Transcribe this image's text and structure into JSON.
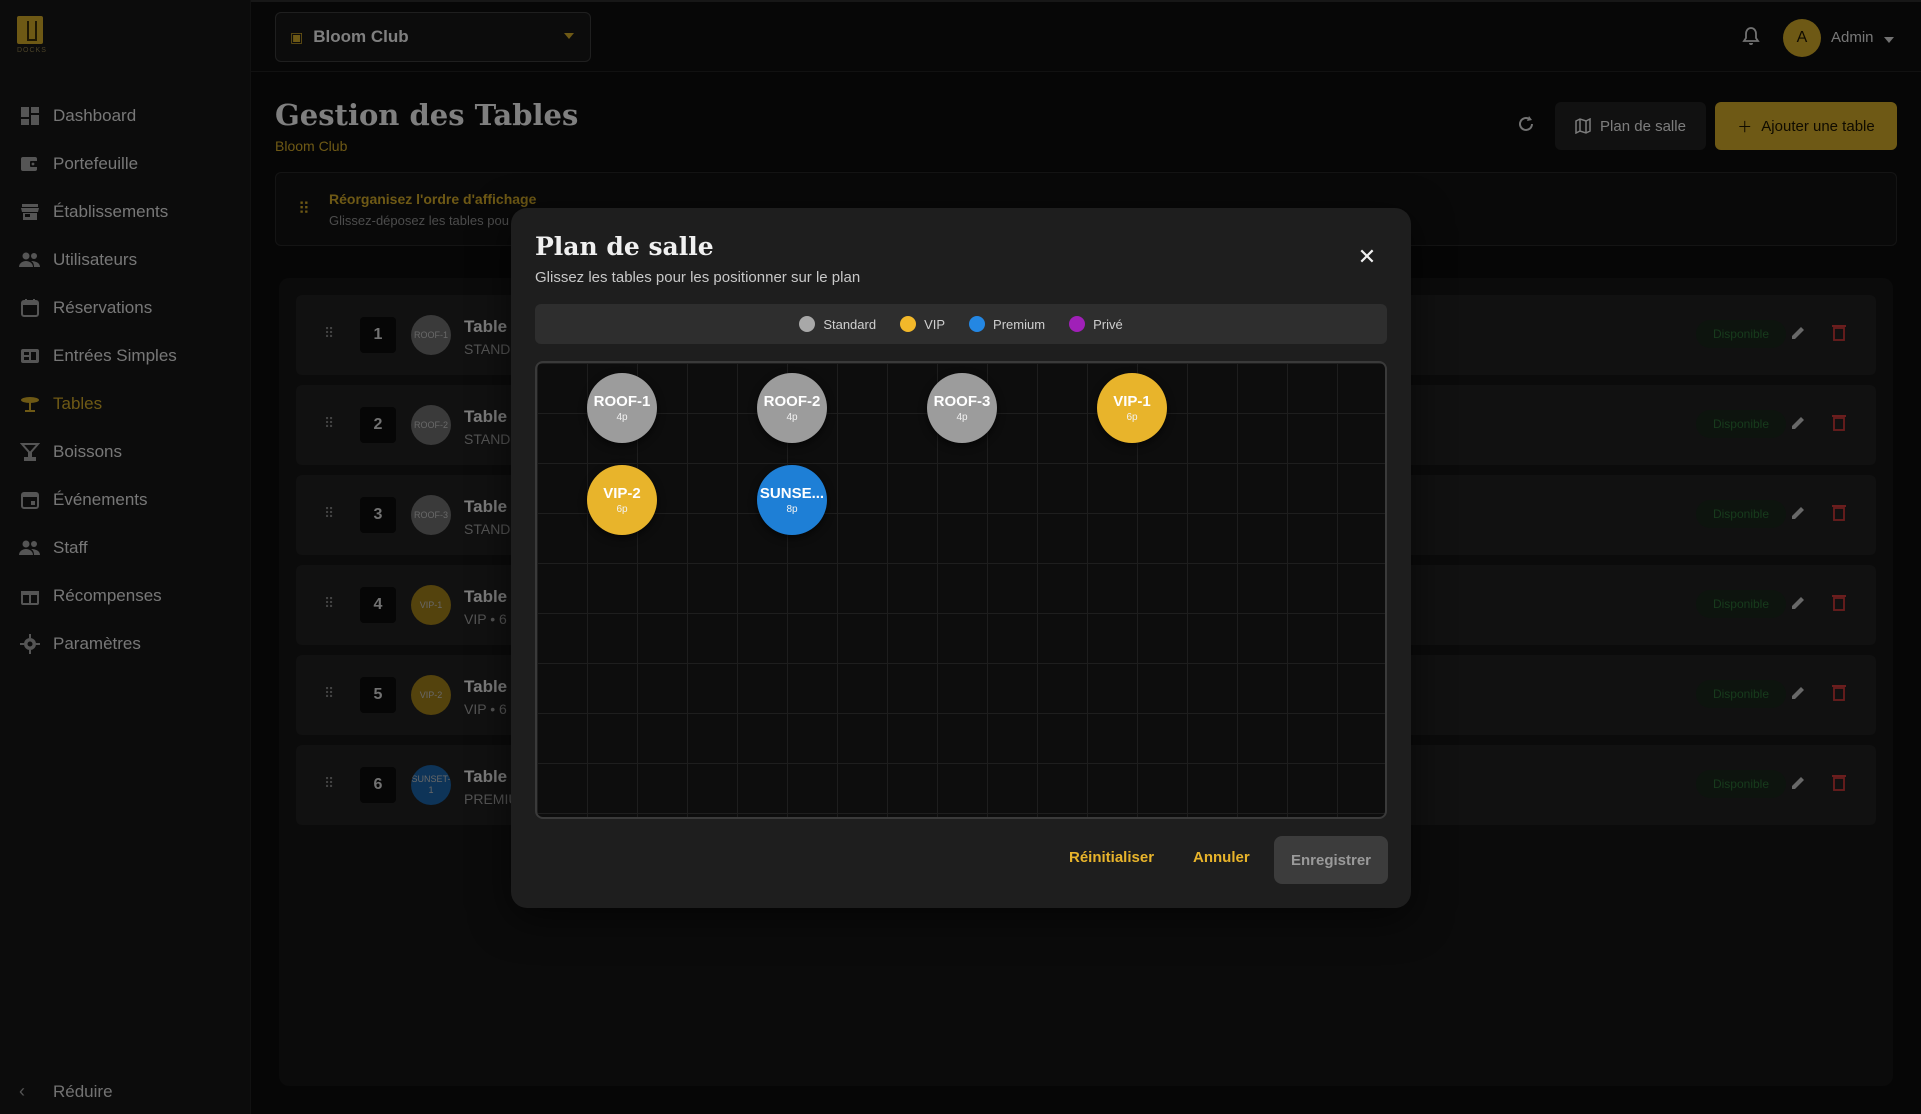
{
  "app": {
    "brand_text": "DOCKS"
  },
  "sidebar": {
    "items": [
      {
        "label": "Dashboard",
        "icon": "dashboard-icon"
      },
      {
        "label": "Portefeuille",
        "icon": "wallet-icon"
      },
      {
        "label": "Établissements",
        "icon": "store-icon"
      },
      {
        "label": "Utilisateurs",
        "icon": "users-icon"
      },
      {
        "label": "Réservations",
        "icon": "calendar-icon"
      },
      {
        "label": "Entrées Simples",
        "icon": "ticket-icon"
      },
      {
        "label": "Tables",
        "icon": "table-icon"
      },
      {
        "label": "Boissons",
        "icon": "cocktail-icon"
      },
      {
        "label": "Événements",
        "icon": "event-icon"
      },
      {
        "label": "Staff",
        "icon": "staff-icon"
      },
      {
        "label": "Récompenses",
        "icon": "gift-icon"
      },
      {
        "label": "Paramètres",
        "icon": "gear-icon"
      }
    ],
    "active": "Tables",
    "collapse_label": "Réduire"
  },
  "topbar": {
    "venue": "Bloom Club",
    "user_initial": "A",
    "user_name": "Admin"
  },
  "header": {
    "title": "Gestion des Tables",
    "subtitle": "Bloom Club",
    "plan_button": "Plan de salle",
    "add_button": "Ajouter une table"
  },
  "info": {
    "title": "Réorganisez l'ordre d'affichage",
    "text": "Glissez-déposez les tables pou"
  },
  "rows": [
    {
      "order": "1",
      "badge": "ROOF-1",
      "name": "Table",
      "meta": "STAND",
      "status": "Disponible",
      "color": "#6a6a6a"
    },
    {
      "order": "2",
      "badge": "ROOF-2",
      "name": "Table",
      "meta": "STAND",
      "status": "Disponible",
      "color": "#6a6a6a"
    },
    {
      "order": "3",
      "badge": "ROOF-3",
      "name": "Table",
      "meta": "STAND",
      "status": "Disponible",
      "color": "#6a6a6a"
    },
    {
      "order": "4",
      "badge": "VIP-1",
      "name": "Table",
      "meta": "VIP • 6",
      "status": "Disponible",
      "color": "#9a7a18"
    },
    {
      "order": "5",
      "badge": "VIP-2",
      "name": "Table",
      "meta": "VIP • 6",
      "status": "Disponible",
      "color": "#9a7a18"
    },
    {
      "order": "6",
      "badge": "SUNSET-1",
      "name": "Table",
      "meta": "PREMIU",
      "status": "Disponible",
      "color": "#1a5fa0"
    }
  ],
  "modal": {
    "title": "Plan de salle",
    "subtitle": "Glissez les tables pour les positionner sur le plan",
    "legend": [
      {
        "label": "Standard",
        "color": "#a8a8a8"
      },
      {
        "label": "VIP",
        "color": "#f2b82a"
      },
      {
        "label": "Premium",
        "color": "#2487e3"
      },
      {
        "label": "Privé",
        "color": "#a020b8"
      }
    ],
    "tables": [
      {
        "name": "ROOF-1",
        "capacity": "4p",
        "type": "std"
      },
      {
        "name": "ROOF-2",
        "capacity": "4p",
        "type": "std"
      },
      {
        "name": "ROOF-3",
        "capacity": "4p",
        "type": "std"
      },
      {
        "name": "VIP-1",
        "capacity": "6p",
        "type": "vip"
      },
      {
        "name": "VIP-2",
        "capacity": "6p",
        "type": "vip"
      },
      {
        "name": "SUNSE...",
        "capacity": "8p",
        "type": "prem"
      }
    ],
    "reset": "Réinitialiser",
    "cancel": "Annuler",
    "save": "Enregistrer"
  }
}
